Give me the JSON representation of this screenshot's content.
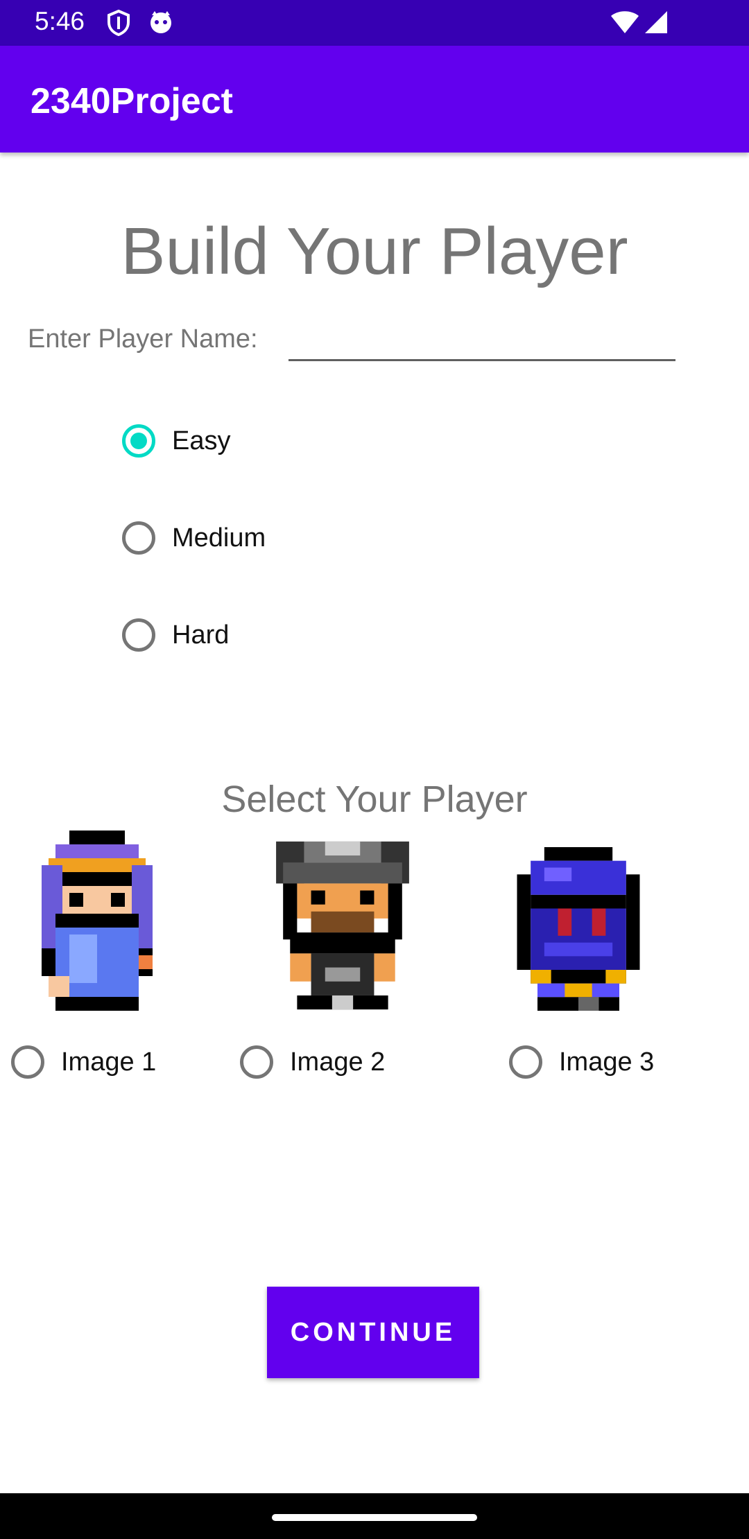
{
  "status_bar": {
    "time": "5:46"
  },
  "app_bar": {
    "title": "2340Project"
  },
  "form": {
    "heading": "Build Your Player",
    "name_label": "Enter Player Name:",
    "name_value": "",
    "difficulty": [
      {
        "label": "Easy",
        "checked": true
      },
      {
        "label": "Medium",
        "checked": false
      },
      {
        "label": "Hard",
        "checked": false
      }
    ],
    "player_heading": "Select Your Player",
    "players": [
      {
        "label": "Image 1",
        "checked": false,
        "sprite": "mage-sprite"
      },
      {
        "label": "Image 2",
        "checked": false,
        "sprite": "warrior-sprite"
      },
      {
        "label": "Image 3",
        "checked": false,
        "sprite": "knight-sprite"
      }
    ],
    "continue_label": "CONTINUE"
  },
  "colors": {
    "status_bar": "#3700b3",
    "app_bar": "#6200ee",
    "accent": "#03dac5",
    "button": "#6200ee"
  }
}
